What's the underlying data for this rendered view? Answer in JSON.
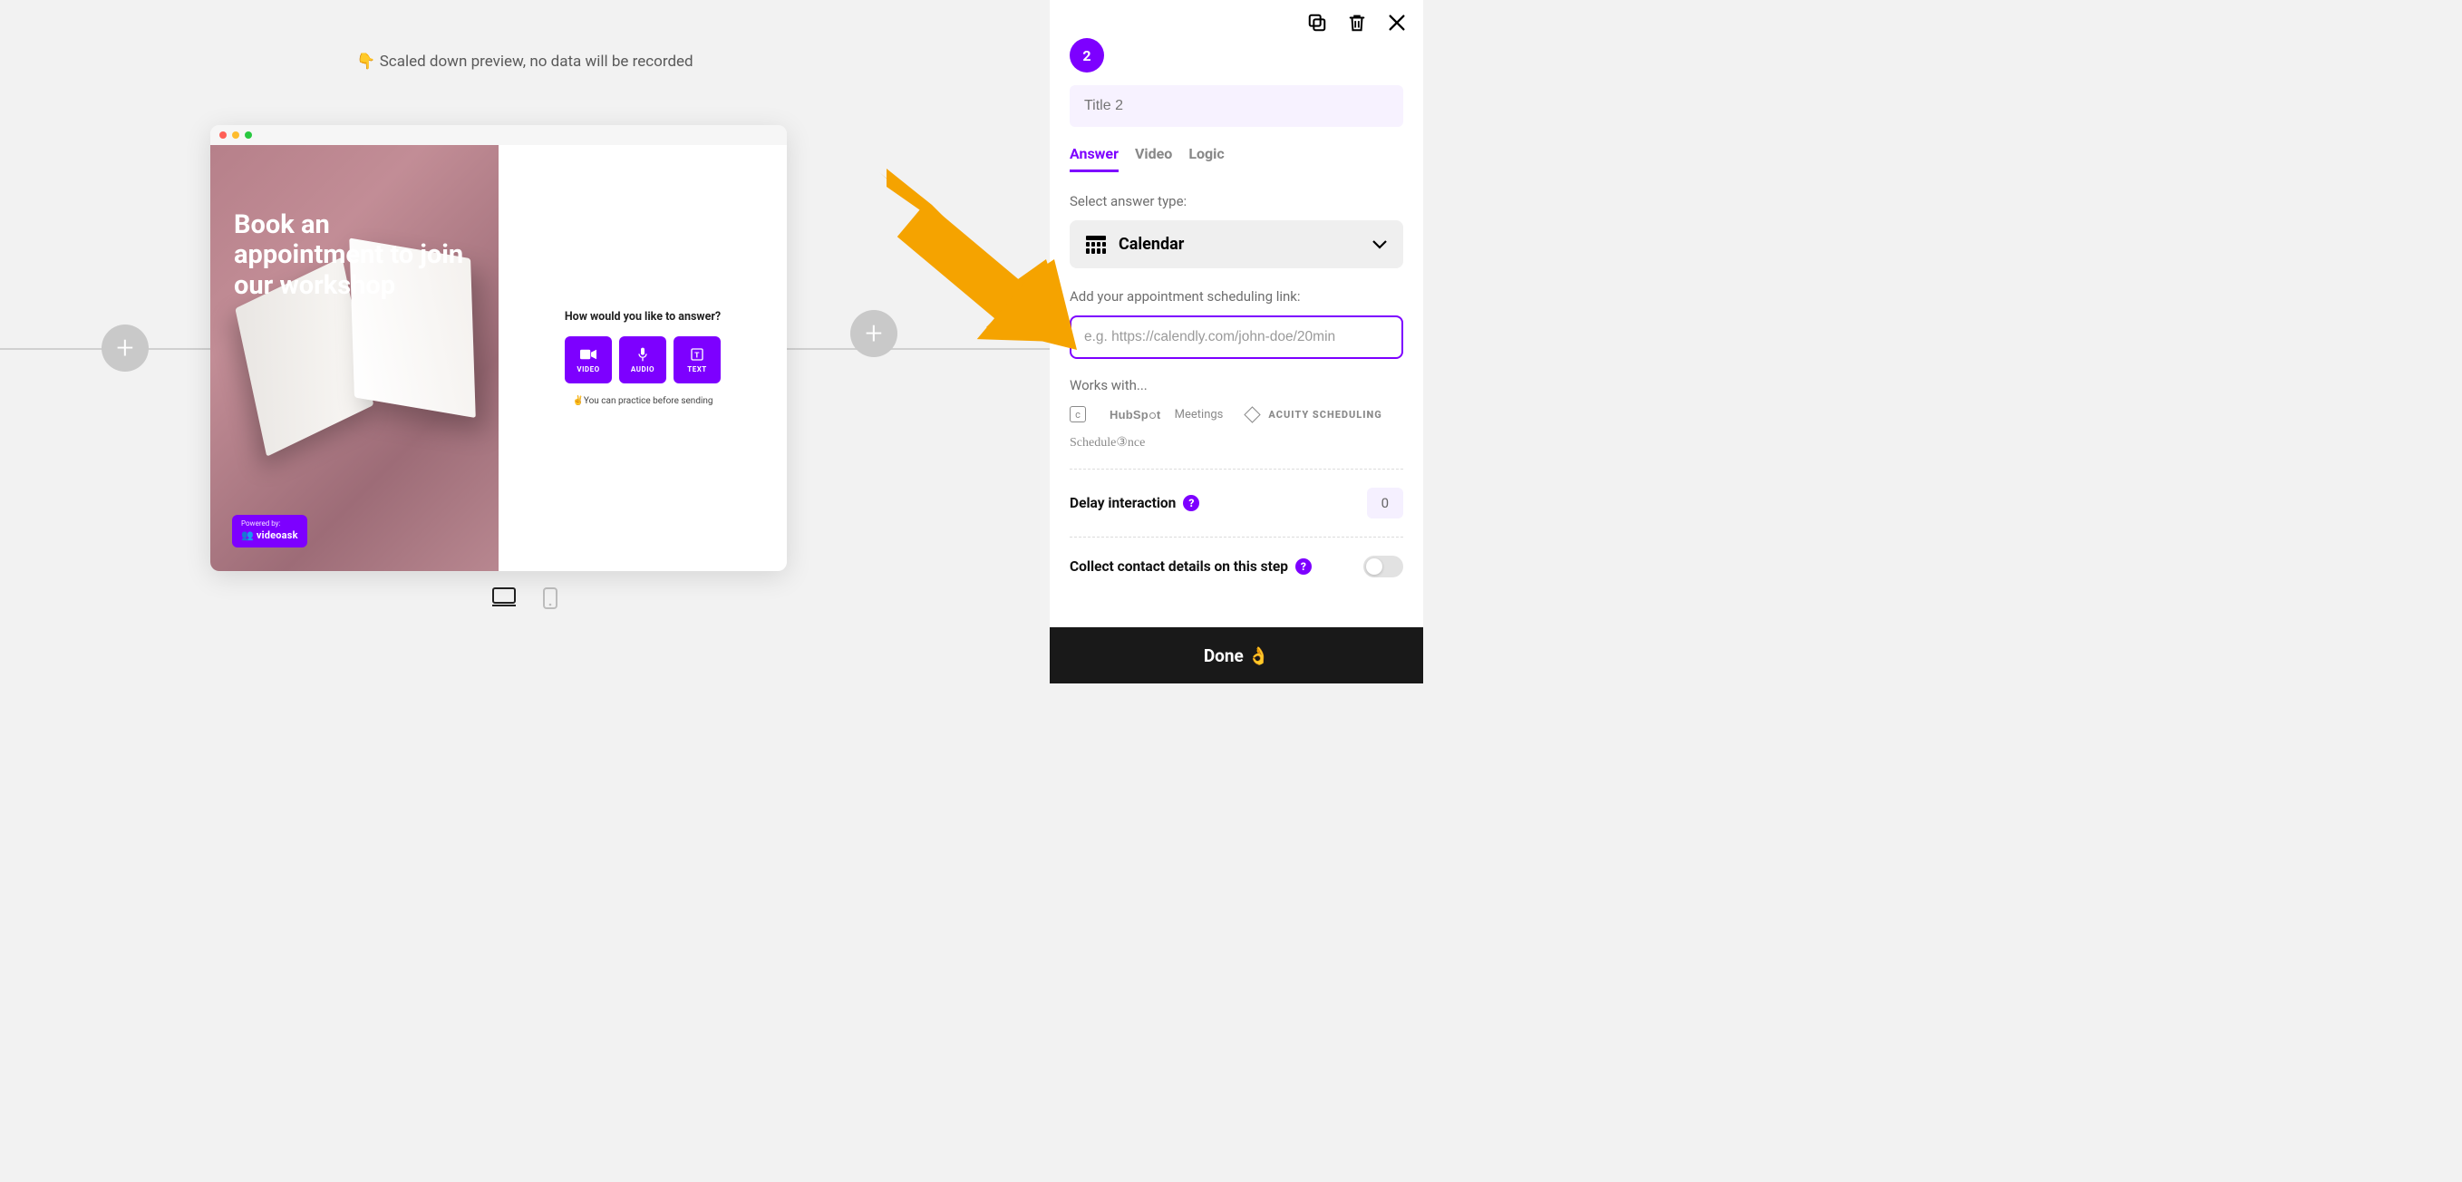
{
  "canvas": {
    "preview_note": "👇 Scaled down preview, no data will be recorded",
    "hero_text": "Book an appointment to join our workshop",
    "powered_by_label": "Powered by:",
    "powered_by_brand": "videoask",
    "answer_prompt": "How would you like to answer?",
    "buttons": {
      "video": "VIDEO",
      "audio": "AUDIO",
      "text": "TEXT"
    },
    "practice_note": "✌️You can practice before sending"
  },
  "panel": {
    "step_number": "2",
    "title_placeholder": "Title 2",
    "tabs": {
      "answer": "Answer",
      "video": "Video",
      "logic": "Logic"
    },
    "select_label": "Select answer type:",
    "dropdown_value": "Calendar",
    "link_label": "Add your appointment scheduling link:",
    "link_placeholder": "e.g. https://calendly.com/john-doe/20min",
    "works_with_label": "Works with...",
    "integrations": {
      "calendly_letter": "c",
      "hubspot": "HubSpot",
      "hubspot_suffix": "Meetings",
      "acuity": "ACUITY SCHEDULING",
      "scheduleonce": "Schedule③nce"
    },
    "delay_label": "Delay interaction",
    "delay_value": "0",
    "collect_label": "Collect contact details on this step",
    "done_label": "Done 👌"
  }
}
